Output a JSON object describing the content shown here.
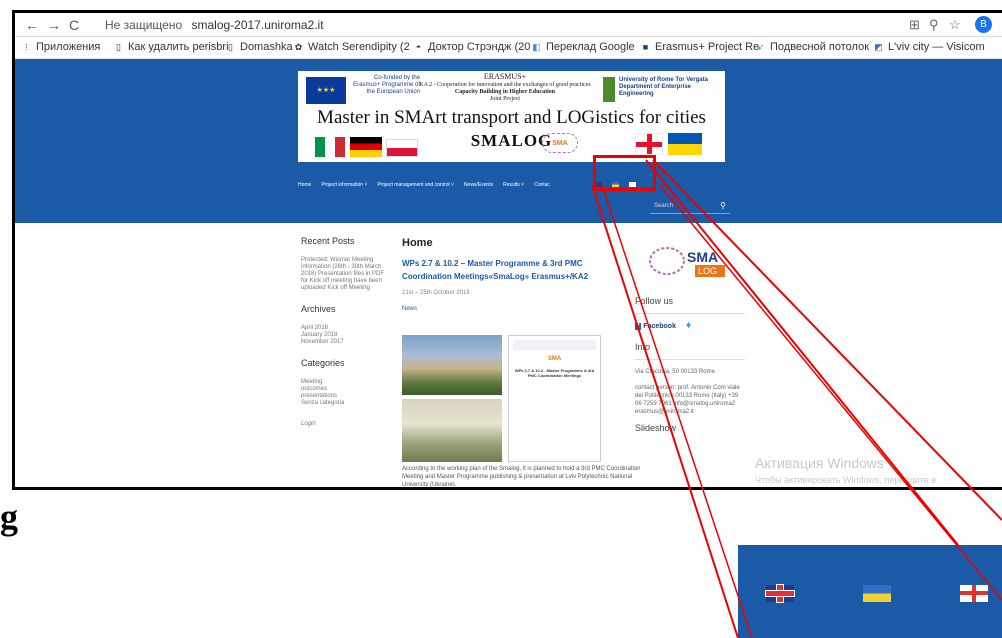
{
  "browser": {
    "url_security": "Не защищено",
    "url": "smalog-2017.uniroma2.it",
    "profile_initial": "B"
  },
  "bookmarks": [
    {
      "label": "Приложения"
    },
    {
      "label": "Как удалить perisbri"
    },
    {
      "label": "Domashka"
    },
    {
      "label": "Watch Serendipity (2"
    },
    {
      "label": "Доктор Стрэндж (20"
    },
    {
      "label": "Переклад Google"
    },
    {
      "label": "Erasmus+ Project Re"
    },
    {
      "label": "Подвесной потолок"
    },
    {
      "label": "L'viv city — Visicom"
    }
  ],
  "banner": {
    "cofunded": "Co-funded by the Erasmus+ Programme of the European Union",
    "erasmus": "ERASMUS+",
    "ka2": "KA 2 - Cooperation for innovation and the exchanges of good practices",
    "capacity": "Capacity Building in Higher Education",
    "joint": "Joint Project",
    "university": "University of Rome Tor Vergata Department of Enterprise Engineering",
    "master_title": "Master in SMArt transport and LOGistics for cities",
    "smalog": "SMALOG",
    "sma_logo": "SMA"
  },
  "nav": {
    "items": [
      "Home",
      "Project information ˅",
      "Project management and control ˅",
      "News/Events",
      "Results ˅",
      "Contac"
    ],
    "search_placeholder": "Search"
  },
  "left_sidebar": {
    "recent_posts_title": "Recent Posts",
    "recent_posts": "Protected: Wismar Meeting information (26th - 30th March 2018) Presentation files in PDF for Kick off meeting have been uploaded Kick off Meeting",
    "archives_title": "Archives",
    "archives": [
      "April 2018",
      "January 2018",
      "November 2017"
    ],
    "categories_title": "Categories",
    "categories": [
      "Meeting",
      "outcomes",
      "presentations",
      "Senza categoria"
    ],
    "login": "Login"
  },
  "main": {
    "heading": "Home",
    "post_title": "WPs 2.7 & 10.2 – Master Programme & 3rd PMC Coordination Meetings«SmaLog» Erasmus+/KA2",
    "date": "21st – 25th October 2018",
    "category": "News",
    "doc_title": "WPs 2.7 & 10.2 - Master Programme & 3rd PMC Coordination Meetings",
    "excerpt": "According to the working plan of the Smalog, it is planned to hold a 3rd PMC Coordination Meeting and Master Programme publishing & presentation at Lviv Polytechnic National University (Ukraine)."
  },
  "right_sidebar": {
    "logo_text": "SMA",
    "logo_sub": "LOG",
    "follow_title": "Follow us",
    "facebook": "Facebook",
    "info_title": "Info",
    "address": "Via Cracovia, 50 00133 Rome",
    "contact": "contact person: prof. Antonio Com viale del Politecnico 00133 Rome (Italy) +39 06 7259 7061 info@smalog.uniroma2 erasmus@uniroma2.it",
    "slideshow_title": "Slideshow"
  },
  "activation": {
    "title": "Активация Windows",
    "subtitle": "Чтобы активировать Windows, перейдите в"
  },
  "caption_fragment": "g",
  "zoom_languages": [
    "uk-flag-icon",
    "ukraine-flag-icon",
    "georgia-flag-icon"
  ],
  "colors": {
    "site_blue": "#1b5aa6",
    "highlight": "#e00000"
  }
}
